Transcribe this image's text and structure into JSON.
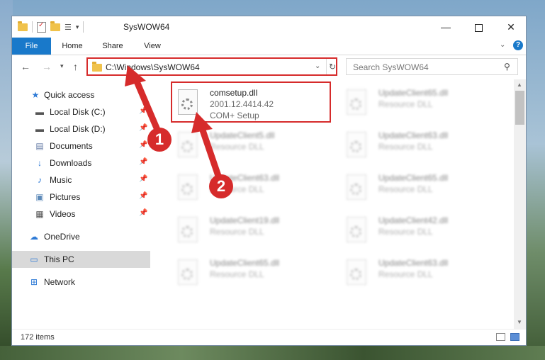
{
  "window": {
    "title": "SysWOW64",
    "min_glyph": "—",
    "close_glyph": "✕"
  },
  "ribbon": {
    "file": "File",
    "home": "Home",
    "share": "Share",
    "view": "View",
    "help_glyph": "?"
  },
  "nav": {
    "address": "C:\\Windows\\SysWOW64",
    "search_placeholder": "Search SysWOW64"
  },
  "sidebar": {
    "items": [
      {
        "label": "Quick access",
        "icon": "star-icon"
      },
      {
        "label": "Local Disk (C:)",
        "icon": "drive-icon"
      },
      {
        "label": "Local Disk (D:)",
        "icon": "drive-icon"
      },
      {
        "label": "Documents",
        "icon": "documents-icon"
      },
      {
        "label": "Downloads",
        "icon": "downloads-icon"
      },
      {
        "label": "Music",
        "icon": "music-icon"
      },
      {
        "label": "Pictures",
        "icon": "pictures-icon"
      },
      {
        "label": "Videos",
        "icon": "videos-icon"
      },
      {
        "label": "OneDrive",
        "icon": "cloud-icon"
      },
      {
        "label": "This PC",
        "icon": "computer-icon"
      },
      {
        "label": "Network",
        "icon": "network-icon"
      }
    ]
  },
  "files": {
    "main": {
      "name": "comsetup.dll",
      "version": "2001.12.4414.42",
      "description": "COM+ Setup"
    },
    "blurred": [
      {
        "name": "UpdateClient65.dll",
        "description": "Resource DLL"
      },
      {
        "name": "UpdateClient5.dll",
        "description": "Resource DLL"
      },
      {
        "name": "UpdateClient63.dll",
        "description": "Resource DLL"
      },
      {
        "name": "UpdateClient63.dll",
        "description": "Resource DLL"
      },
      {
        "name": "UpdateClient65.dll",
        "description": "Resource DLL"
      },
      {
        "name": "UpdateClient19.dll",
        "description": "Resource DLL"
      },
      {
        "name": "UpdateClient42.dll",
        "description": "Resource DLL"
      },
      {
        "name": "UpdateClient65.dll",
        "description": "Resource DLL"
      },
      {
        "name": "UpdateClient63.dll",
        "description": "Resource DLL"
      }
    ]
  },
  "status": {
    "items": "172 items"
  },
  "annotations": {
    "step1": "1",
    "step2": "2",
    "color": "#d62b2b"
  }
}
